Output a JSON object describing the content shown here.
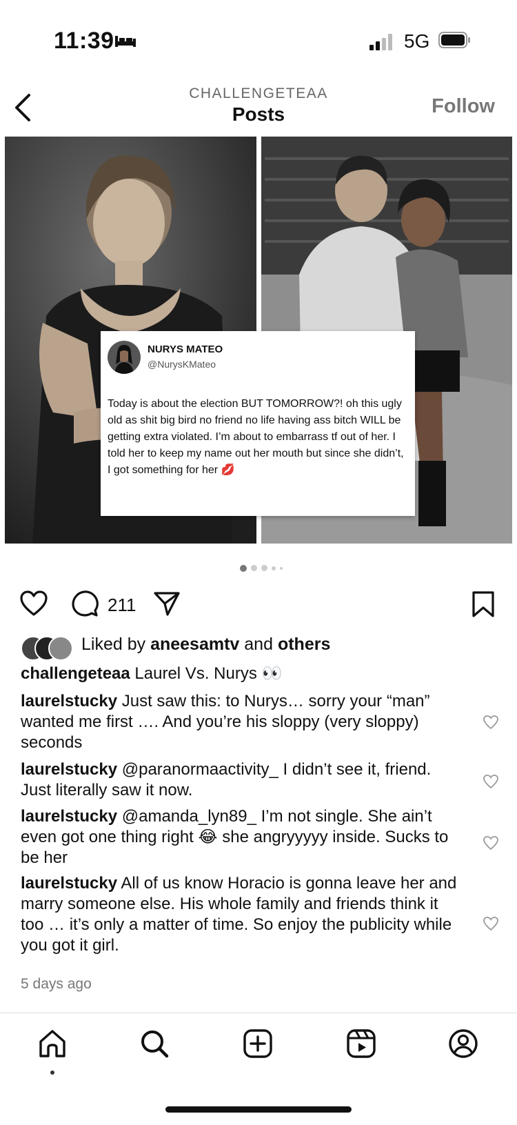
{
  "status_bar": {
    "time": "11:39",
    "network": "5G",
    "icons": [
      "bed-icon",
      "signal-icon",
      "battery-icon"
    ]
  },
  "header": {
    "account": "CHALLENGETEAA",
    "title": "Posts",
    "follow_label": "Follow",
    "back_icon": "chevron-left-icon"
  },
  "post": {
    "tweet": {
      "name": "NURYS MATEO",
      "handle": "@NurysKMateo",
      "text": "Today is about the election BUT TOMORROW?! oh this ugly old as shit big bird no friend no life having ass bitch WILL be getting extra violated. I’m about to embarrass tf out of her. I told her to keep my name out her mouth but since she didn’t, I got something for her 💋"
    },
    "carousel": {
      "count": 5,
      "active": 0
    },
    "comment_count": "211",
    "liked_by_prefix": "Liked by",
    "liked_by_user": "aneesamtv",
    "liked_by_and": "and",
    "liked_by_others": "others",
    "caption_user": "challengeteaa",
    "caption_text": "Laurel Vs. Nurys 👀",
    "comments": [
      {
        "user": "laurelstucky",
        "text": "Just saw this: to Nurys… sorry your “man” wanted me first …. And you’re his sloppy (very sloppy) seconds"
      },
      {
        "user": "laurelstucky",
        "text": "@paranormaactivity_ I didn’t see it, friend. Just literally saw it now."
      },
      {
        "user": "laurelstucky",
        "text": "@amanda_lyn89_ I’m not single. She ain’t even got one thing right 😂 she angryyyyy inside. Sucks to be her"
      },
      {
        "user": "laurelstucky",
        "text": "All of us know Horacio is gonna leave her and marry someone else. His whole family and friends think it too … it’s only a matter of time. So enjoy the publicity while you got it girl."
      }
    ],
    "timestamp": "5 days ago"
  },
  "tabs": [
    "home-icon",
    "search-icon",
    "create-icon",
    "reels-icon",
    "profile-icon"
  ],
  "colors": {
    "text": "#111111",
    "muted": "#777777",
    "divider": "#dddddd"
  }
}
